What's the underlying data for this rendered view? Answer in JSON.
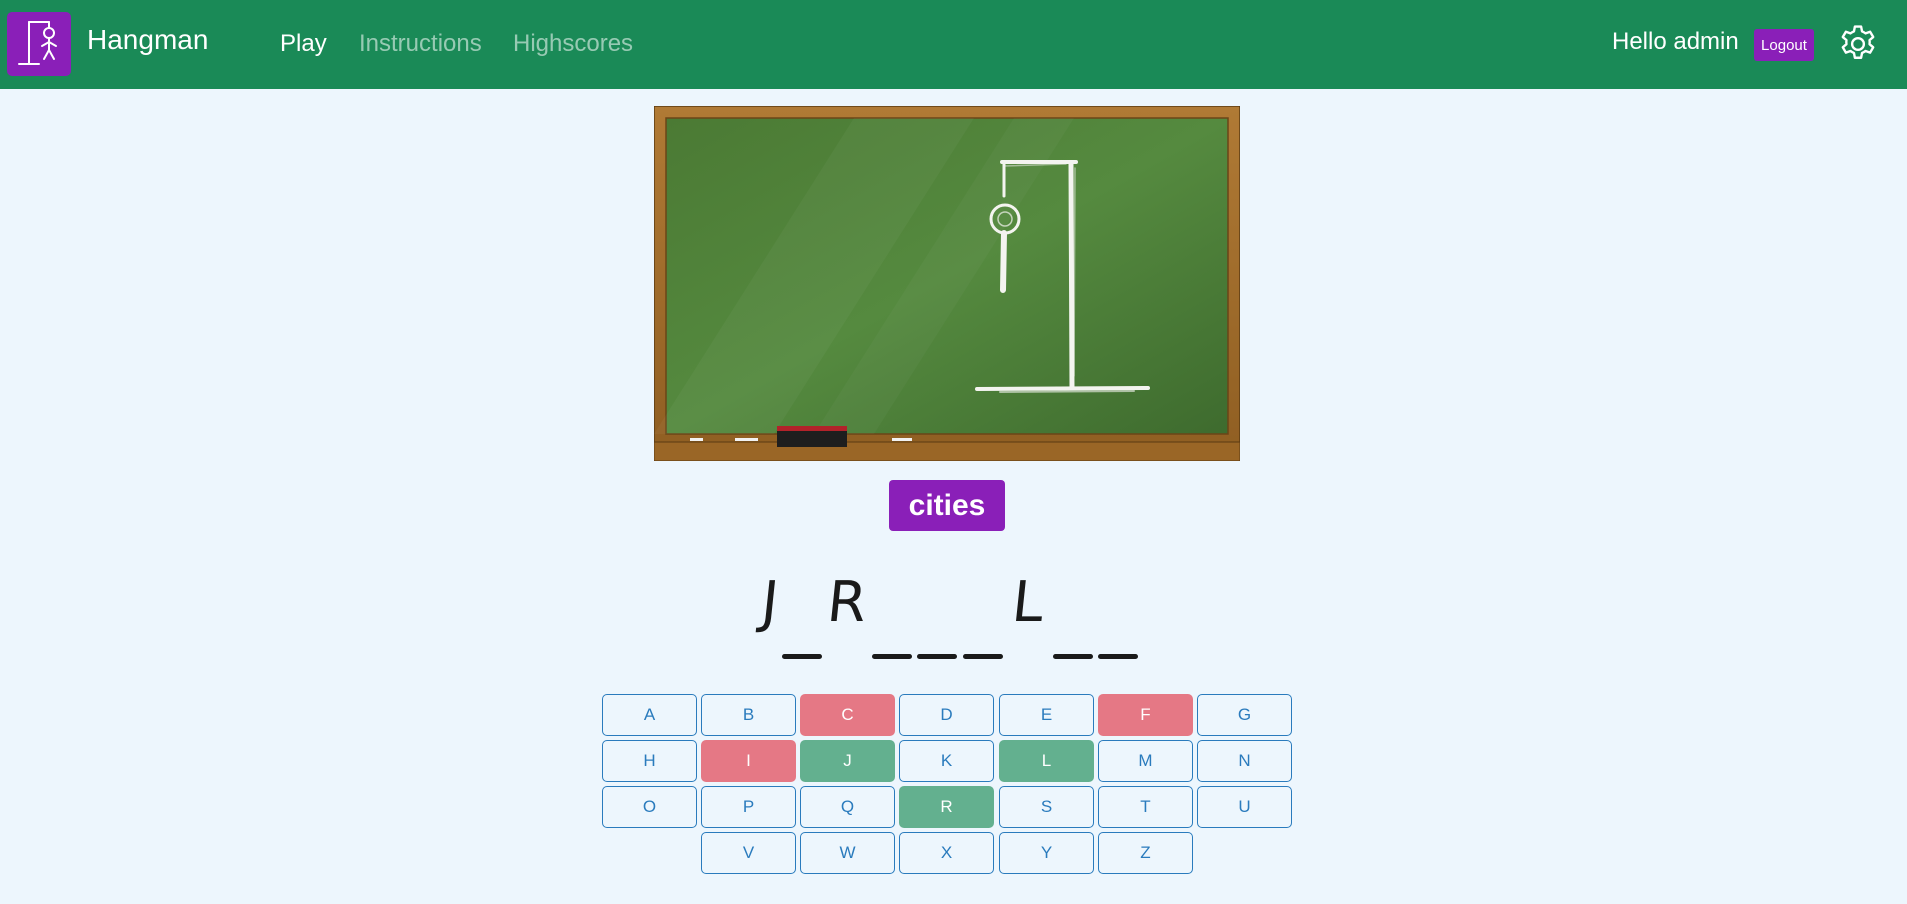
{
  "app": {
    "title": "Hangman"
  },
  "nav": {
    "items": [
      {
        "label": "Play",
        "active": true
      },
      {
        "label": "Instructions",
        "active": false
      },
      {
        "label": "Highscores",
        "active": false
      }
    ]
  },
  "user": {
    "greeting": "Hello admin",
    "logout_label": "Logout"
  },
  "icons": {
    "logo": "hangman-logo-icon",
    "settings": "gear-icon"
  },
  "colors": {
    "navbar": "#1a8a57",
    "accent": "#8a1fb8",
    "page_bg": "#edf6fd",
    "key_border": "#2a7bbd",
    "key_wrong": "#e57885",
    "key_right": "#63b08f"
  },
  "game": {
    "category": "cities",
    "word": [
      "J",
      "",
      "R",
      "",
      "",
      "",
      "L",
      "",
      ""
    ],
    "keys": [
      {
        "letter": "A",
        "state": "unused"
      },
      {
        "letter": "B",
        "state": "unused"
      },
      {
        "letter": "C",
        "state": "wrong"
      },
      {
        "letter": "D",
        "state": "unused"
      },
      {
        "letter": "E",
        "state": "unused"
      },
      {
        "letter": "F",
        "state": "wrong"
      },
      {
        "letter": "G",
        "state": "unused"
      },
      {
        "letter": "H",
        "state": "unused"
      },
      {
        "letter": "I",
        "state": "wrong"
      },
      {
        "letter": "J",
        "state": "right"
      },
      {
        "letter": "K",
        "state": "unused"
      },
      {
        "letter": "L",
        "state": "right"
      },
      {
        "letter": "M",
        "state": "unused"
      },
      {
        "letter": "N",
        "state": "unused"
      },
      {
        "letter": "O",
        "state": "unused"
      },
      {
        "letter": "P",
        "state": "unused"
      },
      {
        "letter": "Q",
        "state": "unused"
      },
      {
        "letter": "R",
        "state": "right"
      },
      {
        "letter": "S",
        "state": "unused"
      },
      {
        "letter": "T",
        "state": "unused"
      },
      {
        "letter": "U",
        "state": "unused"
      },
      {
        "letter": "V",
        "state": "unused"
      },
      {
        "letter": "W",
        "state": "unused"
      },
      {
        "letter": "X",
        "state": "unused"
      },
      {
        "letter": "Y",
        "state": "unused"
      },
      {
        "letter": "Z",
        "state": "unused"
      }
    ]
  }
}
